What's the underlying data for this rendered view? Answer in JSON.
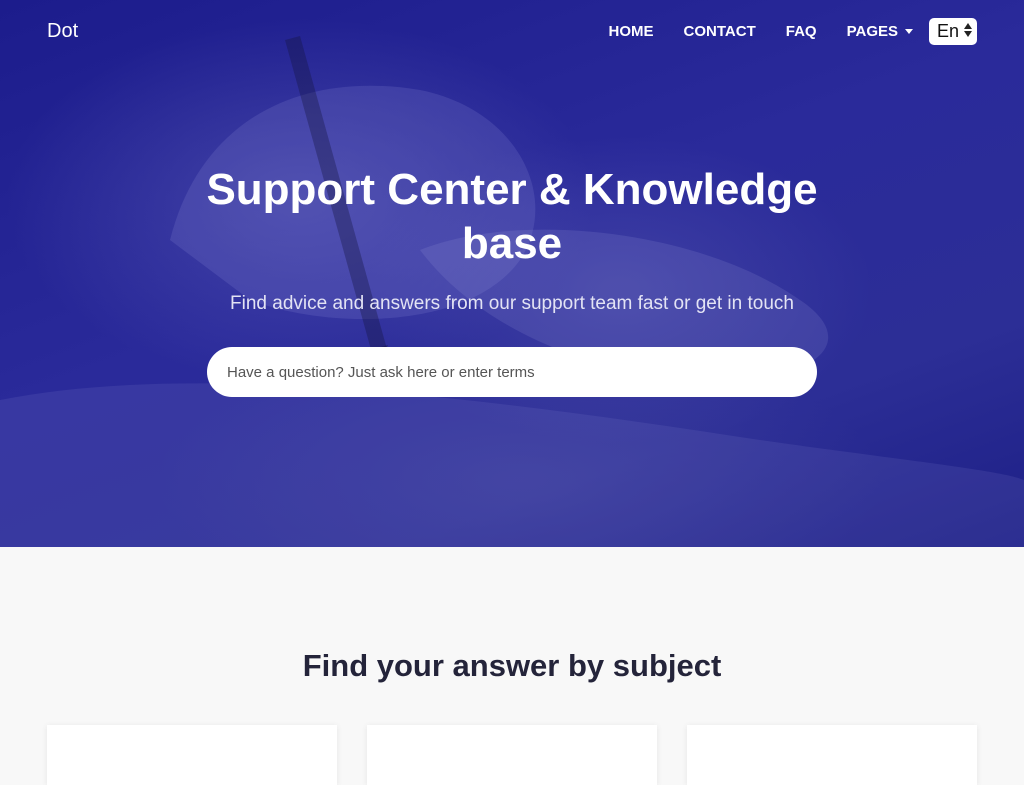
{
  "nav": {
    "brand": "Dot",
    "items": [
      {
        "label": "HOME"
      },
      {
        "label": "CONTACT"
      },
      {
        "label": "FAQ"
      },
      {
        "label": "PAGES"
      }
    ],
    "language": "En"
  },
  "hero": {
    "title": "Support Center & Knowledge base",
    "subtitle": "Find advice and answers from our support team fast or get in touch",
    "search_placeholder": "Have a question? Just ask here or enter terms"
  },
  "subjects": {
    "title": "Find your answer by subject"
  },
  "colors": {
    "hero_overlay": "#2a2a9a",
    "page_bg": "#f8f8f8",
    "heading": "#24243a"
  }
}
